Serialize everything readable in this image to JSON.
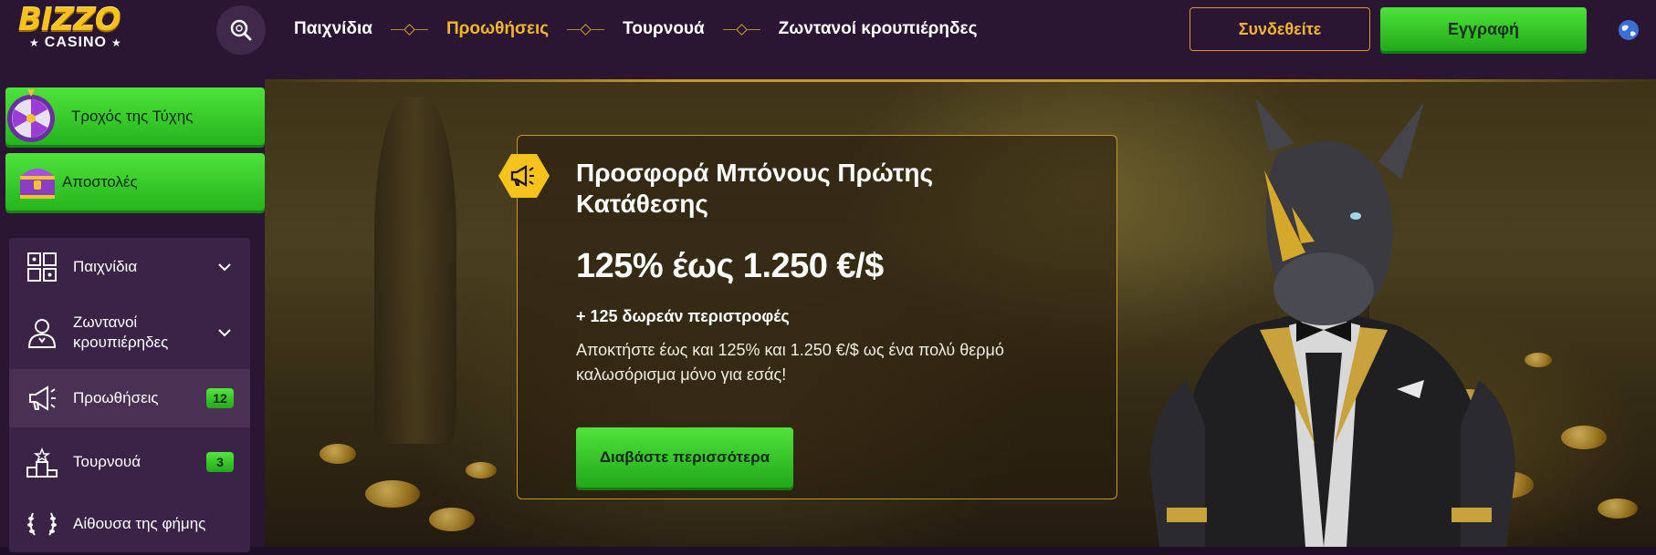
{
  "header": {
    "logo_top": "BIZZO",
    "logo_bottom": "CASINO",
    "nav": [
      {
        "label": "Παιχνίδια",
        "active": false
      },
      {
        "label": "Προωθήσεις",
        "active": true
      },
      {
        "label": "Τουρνουά",
        "active": false
      },
      {
        "label": "Ζωντανοί κρουπιέρηδες",
        "active": false
      }
    ],
    "login_label": "Συνδεθείτε",
    "register_label": "Εγγραφή"
  },
  "sidebar": {
    "cards": [
      {
        "label": "Τροχός της Τύχης",
        "icon": "fortune-wheel-icon"
      },
      {
        "label": "Αποστολές",
        "icon": "treasure-chest-icon"
      }
    ],
    "menu": [
      {
        "label": "Παιχνίδια",
        "icon": "games-icon",
        "expandable": true
      },
      {
        "label": "Ζωντανοί κρουπιέρηδες",
        "icon": "dealer-icon",
        "expandable": true
      },
      {
        "label": "Προωθήσεις",
        "icon": "megaphone-icon",
        "badge": "12",
        "active": true
      },
      {
        "label": "Τουρνουά",
        "icon": "podium-icon",
        "badge": "3"
      },
      {
        "label": "Αίθουσα της φήμης",
        "icon": "laurel-icon"
      }
    ]
  },
  "promo": {
    "title": "Προσφορά Μπόνους Πρώτης Κατάθεσης",
    "amount": "125% έως 1.250 €/$",
    "subtitle": "+ 125 δωρεάν περιστροφές",
    "description": "Αποκτήστε έως και 125% και 1.250 €/$ ως ένα πολύ θερμό καλωσόρισμα μόνο για εσάς!",
    "button_label": "Διαβάστε περισσότερα"
  },
  "colors": {
    "header_bg": "#2a1533",
    "accent_gold": "#f4b72a",
    "green": "#3cc82c",
    "panel": "#3a2347"
  }
}
